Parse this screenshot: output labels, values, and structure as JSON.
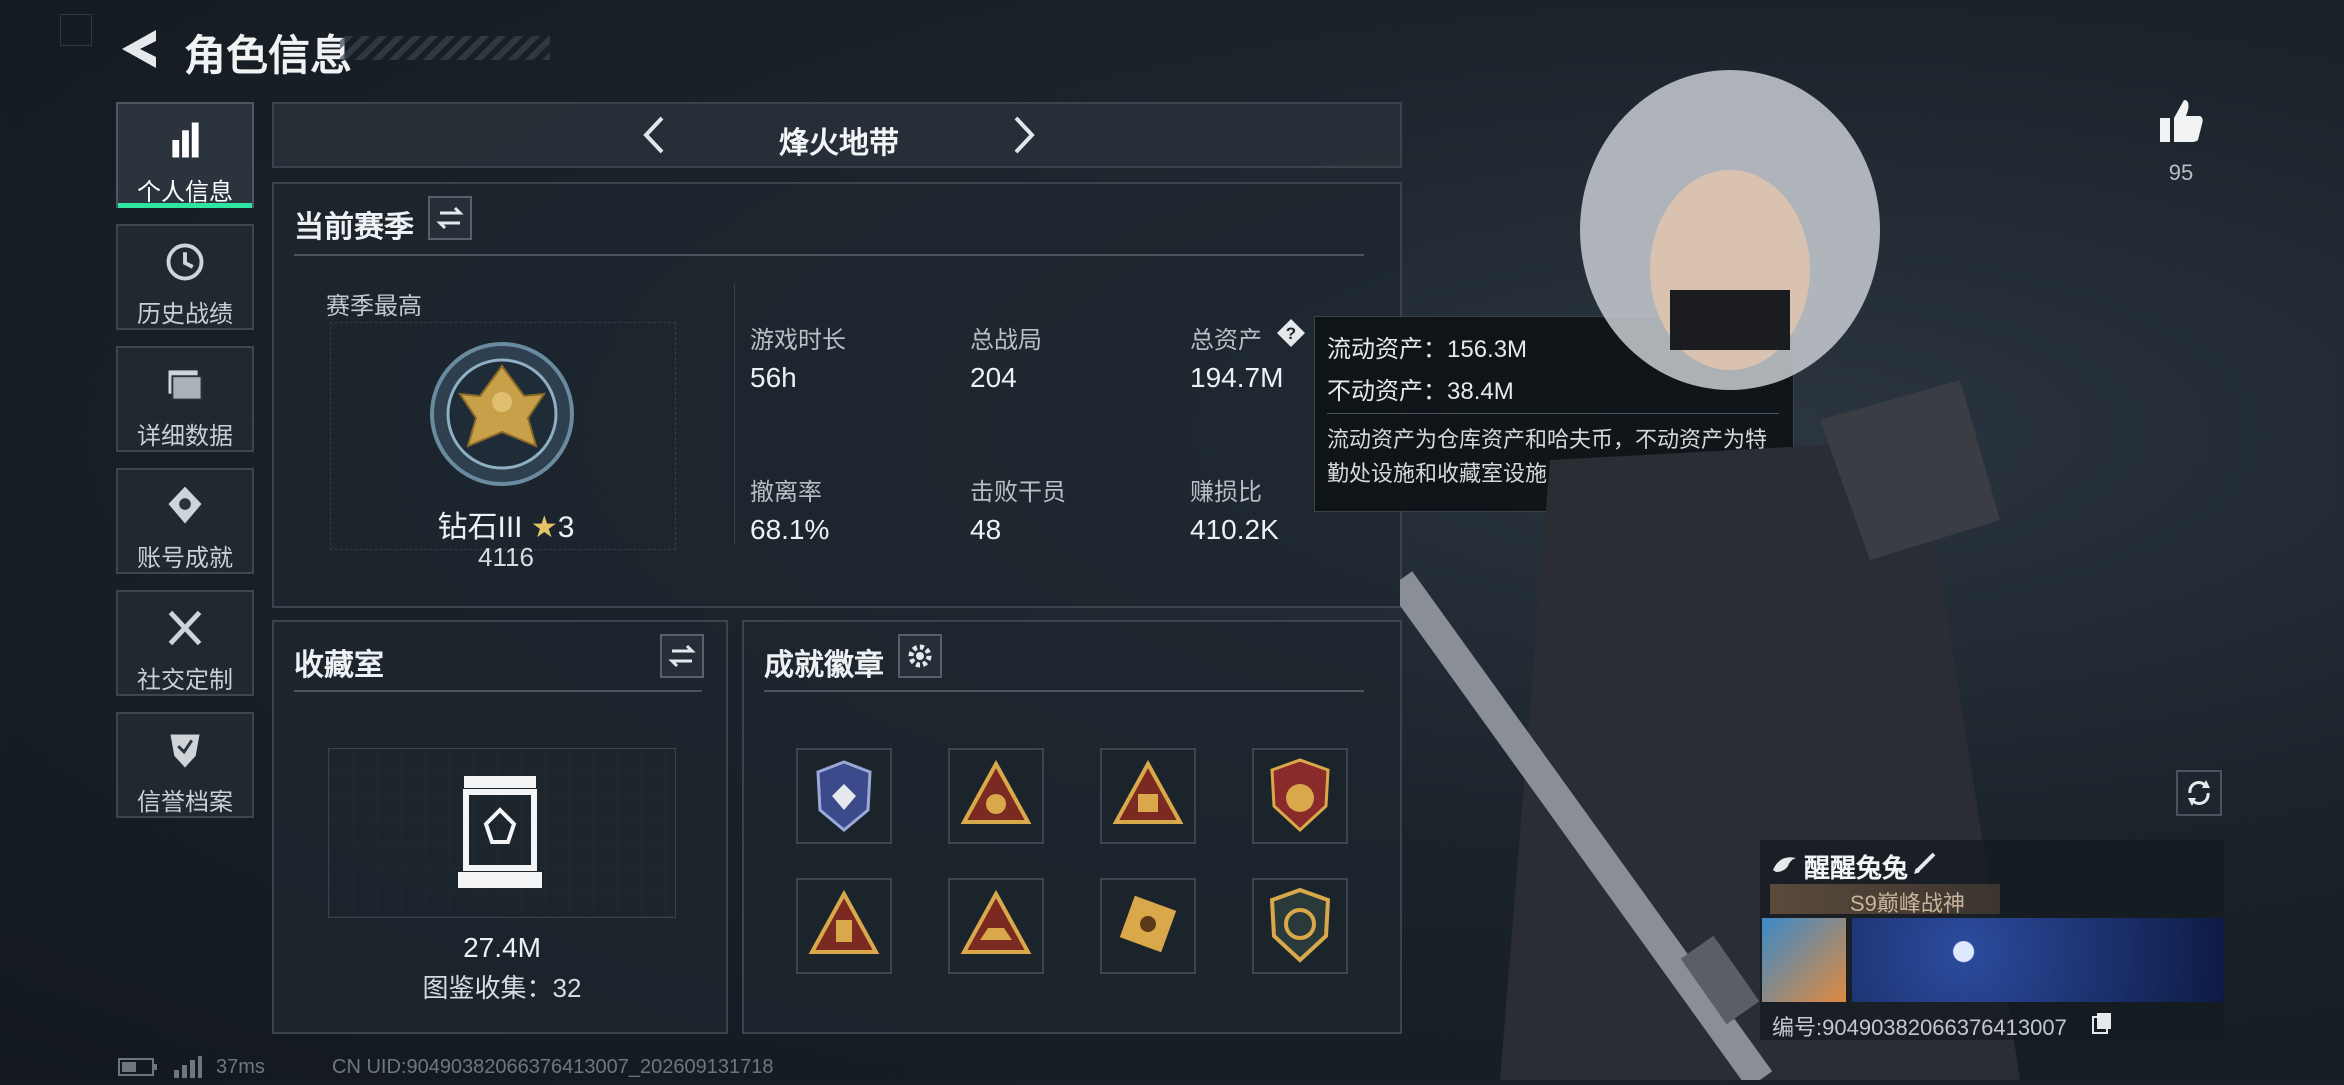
{
  "header": {
    "title": "角色信息"
  },
  "sidebar": {
    "items": [
      {
        "label": "个人信息",
        "icon": "bar-chart-icon",
        "active": true
      },
      {
        "label": "历史战绩",
        "icon": "history-clock-icon"
      },
      {
        "label": "详细数据",
        "icon": "folder-icon"
      },
      {
        "label": "账号成就",
        "icon": "achievement-icon"
      },
      {
        "label": "社交定制",
        "icon": "tools-icon"
      },
      {
        "label": "信誉档案",
        "icon": "credit-shield-icon"
      }
    ]
  },
  "mode_selector": {
    "label": "烽火地带"
  },
  "season": {
    "title": "当前赛季",
    "best_label": "赛季最高",
    "rank_name": "钻石III",
    "rank_stars": "3",
    "rank_points": "4116",
    "stats": [
      {
        "label": "游戏时长",
        "value": "56h"
      },
      {
        "label": "总战局",
        "value": "204"
      },
      {
        "label": "总资产",
        "value": "194.7M"
      },
      {
        "label": "撤离率",
        "value": "68.1%"
      },
      {
        "label": "击败干员",
        "value": "48"
      },
      {
        "label": "赚损比",
        "value": "410.2K"
      }
    ]
  },
  "tooltip": {
    "line1_label": "流动资产：",
    "line1_value": "156.3M",
    "line2_label": "不动资产：",
    "line2_value": "38.4M",
    "description": "流动资产为仓库资产和哈夫币，不动资产为特勤处设施和收藏室设施"
  },
  "collection": {
    "title": "收藏室",
    "value": "27.4M",
    "catalog_label": "图鉴收集：",
    "catalog_count": "32"
  },
  "achievements": {
    "title": "成就徽章",
    "badges": [
      "badge-1",
      "badge-2",
      "badge-3",
      "badge-4",
      "badge-5",
      "badge-6",
      "badge-7",
      "badge-8"
    ]
  },
  "likes": {
    "count": "95"
  },
  "profile": {
    "name": "醒醒兔兔",
    "title_badge": "S9巅峰战神",
    "id_label": "编号:",
    "id_value": "90490382066376413007"
  },
  "status_bar": {
    "ping": "37ms",
    "uid": "CN UID:90490382066376413007_202609131718"
  },
  "colors": {
    "accent": "#2ee6a0",
    "gold": "#c9a04a",
    "panel": "#1e262e"
  }
}
